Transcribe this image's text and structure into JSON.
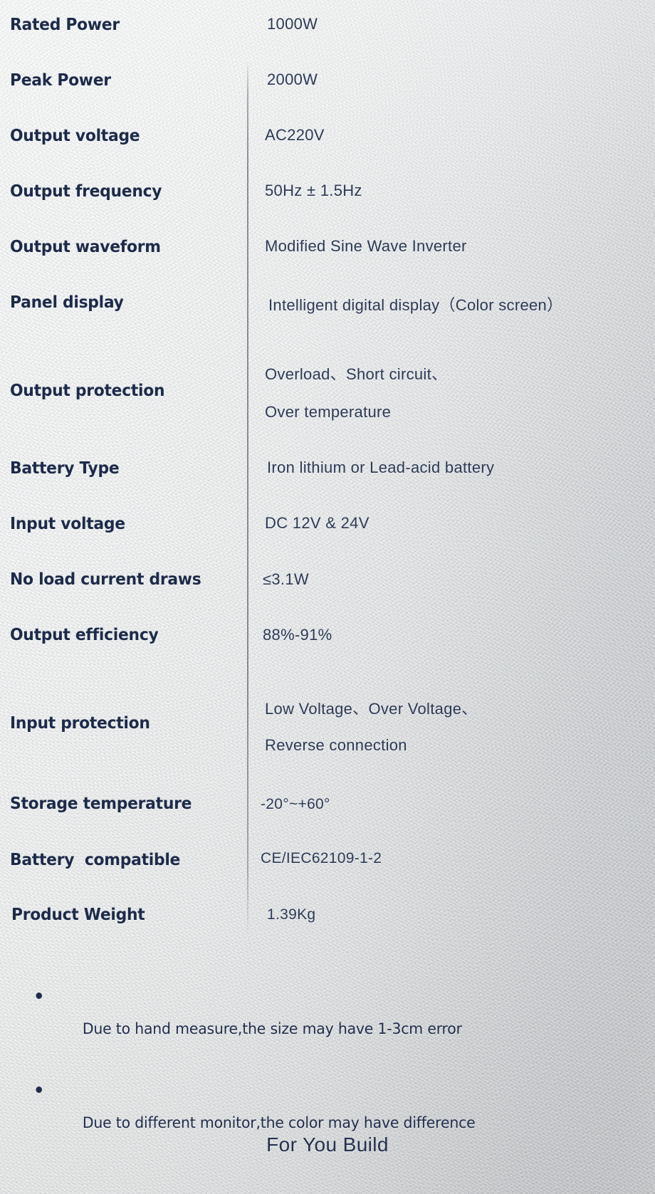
{
  "colors": {
    "label_text": "#1d2b4a",
    "value_text": "#2b3a56",
    "tagline_text": "#24324f",
    "bullet": "#1f2d4c",
    "divider": "#606a72",
    "background_light": "#f6f7f7",
    "background_dark": "#c3c6c9"
  },
  "spec_table": {
    "rows": [
      {
        "label": "Rated Power",
        "value": "1000W",
        "value2": ""
      },
      {
        "label": "Peak Power",
        "value": "2000W",
        "value2": ""
      },
      {
        "label": "Output voltage",
        "value": "AC220V",
        "value2": ""
      },
      {
        "label": "Output frequency",
        "value": "50Hz ± 1.5Hz",
        "value2": ""
      },
      {
        "label": "Output waveform",
        "value": "Modified Sine Wave Inverter",
        "value2": ""
      },
      {
        "label": "Panel display",
        "value": "Intelligent digital display（Color screen）",
        "value2": ""
      },
      {
        "label": "Output protection",
        "value": "Overload、Short circuit、",
        "value2": "Over temperature"
      },
      {
        "label": "Battery Type",
        "value": "Iron lithium or Lead-acid battery",
        "value2": ""
      },
      {
        "label": "Input voltage",
        "value": "DC 12V & 24V",
        "value2": ""
      },
      {
        "label": "No load current draws",
        "value": "≤3.1W",
        "value2": ""
      },
      {
        "label": "Output efficiency",
        "value": "88%-91%",
        "value2": ""
      },
      {
        "label": "Input protection",
        "value": "Low Voltage、Over Voltage、",
        "value2": "Reverse connection"
      },
      {
        "label": "Storage temperature",
        "value": "-20°~+60°",
        "value2": ""
      },
      {
        "label": "Battery  compatible",
        "value": "CE/IEC62109-1-2",
        "value2": ""
      },
      {
        "label": "Product Weight",
        "value": "1.39Kg",
        "value2": ""
      }
    ]
  },
  "footer": {
    "notes": [
      "Due to hand measure,the size may have 1-3cm error",
      "Due to different monitor,the color may have difference"
    ],
    "tagline": "For You Build"
  }
}
